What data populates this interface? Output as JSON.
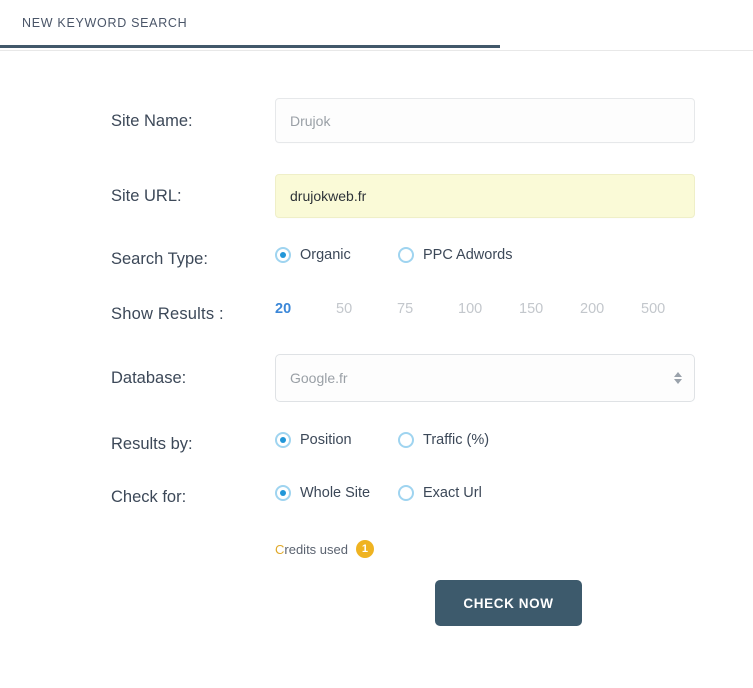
{
  "tabs": [
    {
      "label": "NEW KEYWORD SEARCH",
      "active": true
    }
  ],
  "form": {
    "site_name": {
      "label": "Site Name:",
      "value": "",
      "placeholder": "Drujok"
    },
    "site_url": {
      "label": "Site URL:",
      "value": "drujokweb.fr",
      "placeholder": "",
      "highlight_color": "#fafad7"
    },
    "search_type": {
      "label": "Search Type:",
      "options": [
        {
          "label": "Organic",
          "selected": true
        },
        {
          "label": "PPC Adwords",
          "selected": false
        }
      ]
    },
    "show_results": {
      "label": "Show Results  :",
      "options": [
        {
          "label": "20",
          "selected": true
        },
        {
          "label": "50",
          "selected": false
        },
        {
          "label": "75",
          "selected": false
        },
        {
          "label": "100",
          "selected": false
        },
        {
          "label": "150",
          "selected": false
        },
        {
          "label": "200",
          "selected": false
        },
        {
          "label": "500",
          "selected": false
        }
      ],
      "active_color": "#3b87d8",
      "inactive_color": "#c3c7cc"
    },
    "database": {
      "label": "Database:",
      "value": "Google.fr"
    },
    "results_by": {
      "label": "Results by:",
      "options": [
        {
          "label": "Position",
          "selected": true
        },
        {
          "label": "Traffic (%)",
          "selected": false
        }
      ]
    },
    "check_for": {
      "label": "Check for:",
      "options": [
        {
          "label": "Whole Site",
          "selected": true
        },
        {
          "label": "Exact Url",
          "selected": false
        }
      ]
    },
    "credits": {
      "text_first": "C",
      "text_rest": "redits used",
      "count": "1",
      "badge_color": "#efb321"
    },
    "submit": {
      "label": "CHECK NOW",
      "color": "#3d5a6c"
    }
  },
  "theme": {
    "tab_underline": "#41586a",
    "radio_ring": "#9fd4f0",
    "radio_dot": "#2196d8"
  }
}
